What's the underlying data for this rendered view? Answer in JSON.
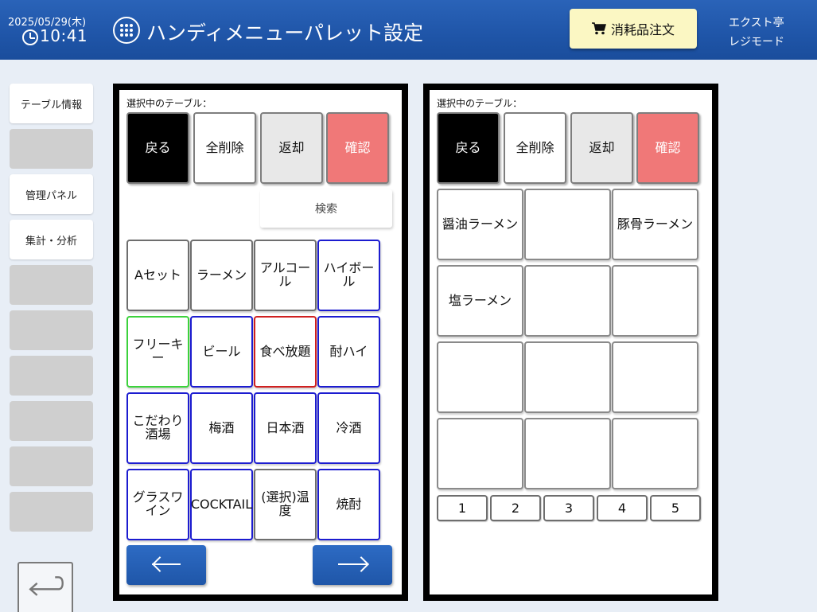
{
  "header": {
    "date": "2025/05/29(木)",
    "time": "10:41",
    "title": "ハンディメニューパレット設定",
    "order_button": "消耗品注文",
    "store_name": "エクスト亭",
    "mode": "レジモード"
  },
  "sidebar": {
    "items": [
      {
        "label": "テーブル情報",
        "style": "white"
      },
      {
        "label": "",
        "style": "gray"
      },
      {
        "label": "管理パネル",
        "style": "white"
      },
      {
        "label": "集計・分析",
        "style": "white"
      },
      {
        "label": "",
        "style": "gray"
      },
      {
        "label": "",
        "style": "gray"
      },
      {
        "label": "",
        "style": "gray"
      },
      {
        "label": "",
        "style": "gray"
      },
      {
        "label": "",
        "style": "gray"
      },
      {
        "label": "",
        "style": "gray"
      }
    ]
  },
  "left_panel": {
    "selected_table_label": "選択中のテーブル：",
    "actions": {
      "back": "戻る",
      "clear_all": "全削除",
      "return": "返却",
      "confirm": "確認"
    },
    "search_label": "検索",
    "categories": [
      {
        "label": "Aセット",
        "color": "dark"
      },
      {
        "label": "ラーメン",
        "color": "dark"
      },
      {
        "label": "アルコール",
        "color": "dark"
      },
      {
        "label": "ハイボール",
        "color": "blue"
      },
      {
        "label": "フリーキー",
        "color": "green"
      },
      {
        "label": "ビール",
        "color": "blue"
      },
      {
        "label": "食べ放題",
        "color": "red"
      },
      {
        "label": "酎ハイ",
        "color": "blue"
      },
      {
        "label": "こだわり酒場",
        "color": "blue"
      },
      {
        "label": "梅酒",
        "color": "blue"
      },
      {
        "label": "日本酒",
        "color": "blue"
      },
      {
        "label": "冷酒",
        "color": "blue"
      },
      {
        "label": "グラスワイン",
        "color": "blue"
      },
      {
        "label": "COCKTAIL",
        "color": "blue"
      },
      {
        "label": "(選択)温度",
        "color": "dark"
      },
      {
        "label": "焼酎",
        "color": "blue"
      }
    ]
  },
  "right_panel": {
    "selected_table_label": "選択中のテーブル：",
    "actions": {
      "back": "戻る",
      "clear_all": "全削除",
      "return": "返却",
      "confirm": "確認"
    },
    "menu_items": [
      "醤油ラーメン",
      "",
      "豚骨ラーメン",
      "塩ラーメン",
      "",
      "",
      "",
      "",
      "",
      "",
      "",
      ""
    ],
    "pages": [
      "1",
      "2",
      "3",
      "4",
      "5"
    ]
  }
}
